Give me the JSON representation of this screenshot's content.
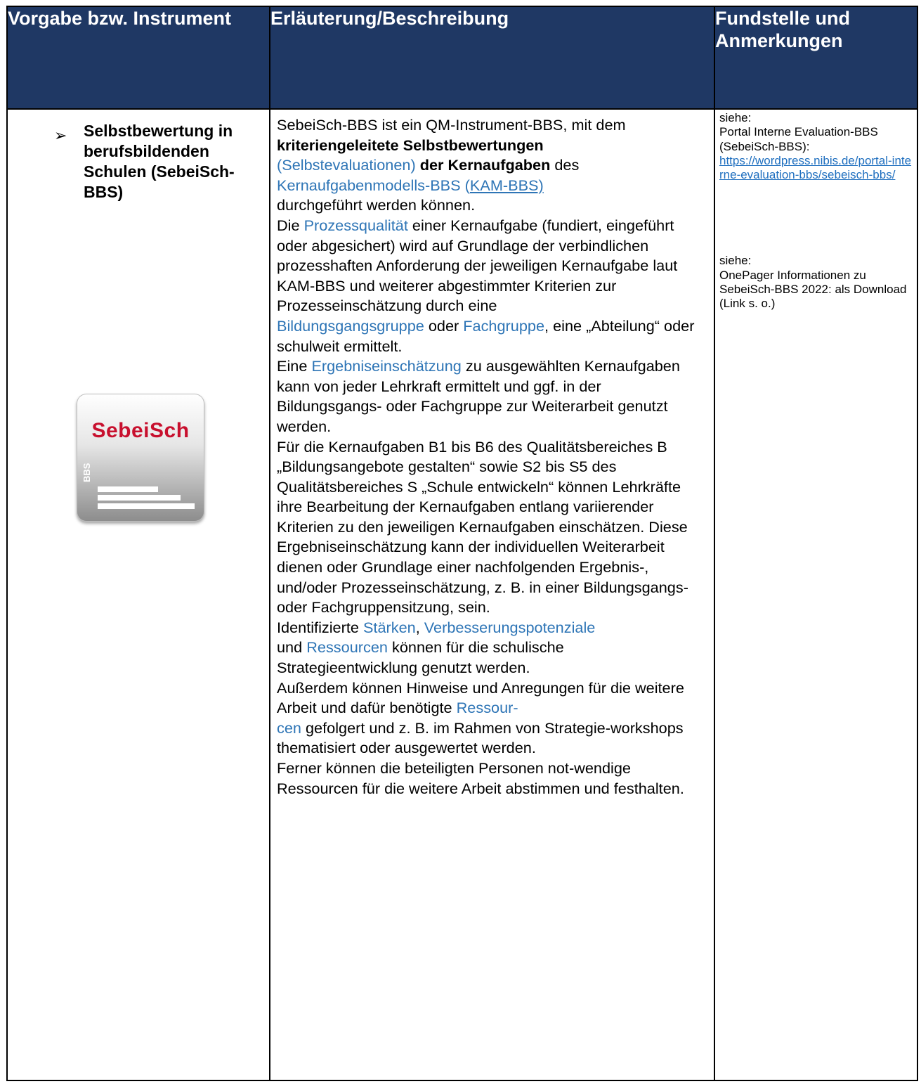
{
  "header": {
    "col1": "Vorgabe bzw. Instrument",
    "col2": "Erläuterung/Beschreibung",
    "col3": "Fundstelle und Anmerkungen"
  },
  "instrument": {
    "bullet": "➢",
    "title": "Selbstbewertung in berufsbildenden Schulen (SebeiSch-BBS)"
  },
  "logo": {
    "brand": "SebeiSch",
    "tag": "BBS"
  },
  "description": {
    "p1_a": "SebeiSch-BBS ist ein QM-Instrument-BBS, mit dem ",
    "p1_bold1": "kriteriengeleitete Selbstbewertungen",
    "p1_link1": "(Selbstevaluationen)",
    "p1_bold2": "der Kernaufgaben",
    "p1_b": " des",
    "p1_link2": "Kernaufgabenmodells-BBS",
    "p1_link3_open": "(",
    "p1_link3": "KAM-BBS)",
    "p1_c": "durchgeführt werden können.",
    "p2_a": "Die ",
    "p2_link": "Prozessqualität",
    "p2_b": " einer Kernaufgabe (fundiert, eingeführt oder abgesichert) wird auf Grundlage der verbindlichen prozesshaften Anforderung der jeweiligen Kernaufgabe laut KAM-BBS und weiterer abgestimmter Kriterien zur Prozesseinschätzung durch eine",
    "p2_link2": "Bildungsgangsgruppe",
    "p2_c": " oder ",
    "p2_link3": "Fachgruppe",
    "p2_d": ", eine „Abteilung“ oder schulweit ermittelt.",
    "p3_a": "Eine ",
    "p3_link": "Ergebniseinschätzung",
    "p3_b": " zu ausgewählten Kernaufgaben kann von jeder Lehrkraft ermittelt und ggf. in der Bildungsgangs- oder Fachgruppe zur Weiterarbeit genutzt werden.",
    "p4": "Für die Kernaufgaben B1 bis B6 des Qualitätsbereiches B „Bildungsangebote gestalten“ sowie S2 bis S5 des Qualitätsbereiches S „Schule entwickeln“ können Lehrkräfte ihre Bearbeitung der Kernaufgaben entlang variierender Kriterien zu den jeweiligen Kernaufgaben einschätzen. Diese Ergebniseinschätzung kann der individuellen Weiterarbeit dienen oder Grundlage einer nachfolgenden Ergebnis-, und/oder Prozesseinschätzung, z. B. in einer Bildungsgangs- oder Fachgruppensitzung, sein.",
    "p5_a": "Identifizierte ",
    "p5_link1": "Stärken",
    "p5_b": ", ",
    "p5_link2": "Verbesserungspotenziale",
    "p5_link3": "Ressourcen",
    "p5_c": " können für die schulische Strategieentwicklung genutzt werden.",
    "p5_und": "und ",
    "p6_a": "Außerdem können Hinweise und Anregungen für die weitere Arbeit und dafür benötigte ",
    "p6_link1": "Ressour-",
    "p6_link2": "cen",
    "p6_b": " gefolgert und z. B. im Rahmen von Strategie-workshops thematisiert oder ausgewertet werden.",
    "p7": "Ferner können die beteiligten Personen not-wendige Ressourcen für die weitere Arbeit abstimmen und festhalten."
  },
  "notes": {
    "n1_label": "siehe:",
    "n1_text": "Portal Interne Evaluation-BBS (SebeiSch-BBS):",
    "n1_link": "https://wordpress.nibis.de/portal-interne-evaluation-bbs/sebeisch-bbs/",
    "n2_label": "siehe:",
    "n2_text": "OnePager Informationen zu SebeiSch-BBS 2022: als Download (Link s. o.)"
  }
}
